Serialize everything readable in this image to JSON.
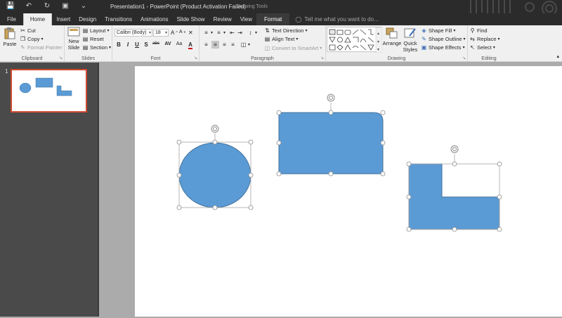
{
  "titlebar": {
    "title": "Presentation1 - PowerPoint (Product Activation Failed)",
    "contextual_group": "Drawing Tools",
    "qat": [
      "save-icon",
      "undo-icon",
      "redo-icon",
      "present-icon",
      "customize-icon"
    ]
  },
  "tabs": [
    {
      "label": "File",
      "state": ""
    },
    {
      "label": "Home",
      "state": "active"
    },
    {
      "label": "Insert",
      "state": ""
    },
    {
      "label": "Design",
      "state": ""
    },
    {
      "label": "Transitions",
      "state": ""
    },
    {
      "label": "Animations",
      "state": ""
    },
    {
      "label": "Slide Show",
      "state": ""
    },
    {
      "label": "Review",
      "state": ""
    },
    {
      "label": "View",
      "state": ""
    },
    {
      "label": "Format",
      "state": "format"
    }
  ],
  "tell_me": "Tell me what you want to do...",
  "ribbon": {
    "clipboard": {
      "label": "Clipboard",
      "paste": "Paste",
      "cut": "Cut",
      "copy": "Copy",
      "format_painter": "Format Painter"
    },
    "slides": {
      "label": "Slides",
      "new_slide_1": "New",
      "new_slide_2": "Slide",
      "layout": "Layout",
      "reset": "Reset",
      "section": "Section"
    },
    "font": {
      "label": "Font",
      "font_name": "Calibri (Body)",
      "font_size": "18",
      "bold": "B",
      "italic": "I",
      "underline": "U",
      "shadow": "S",
      "strike": "abc",
      "spacing": "AV",
      "case": "Aa",
      "color": "A"
    },
    "paragraph": {
      "label": "Paragraph",
      "text_direction": "Text Direction",
      "align_text": "Align Text",
      "convert_smartart": "Convert to SmartArt"
    },
    "drawing": {
      "label": "Drawing",
      "arrange": "Arrange",
      "quick_styles_1": "Quick",
      "quick_styles_2": "Styles",
      "shape_fill": "Shape Fill",
      "shape_outline": "Shape Outline",
      "shape_effects": "Shape Effects"
    },
    "editing": {
      "label": "Editing",
      "find": "Find",
      "replace": "Replace",
      "select": "Select"
    }
  },
  "slide_panel": {
    "slide_number": "1"
  },
  "colors": {
    "shape_fill": "#5b9bd5",
    "shape_stroke": "#41719c",
    "selection_border": "#d04a2f",
    "ribbon_bg": "#f0f0f0",
    "titlebar_bg": "#2b2b2b"
  }
}
